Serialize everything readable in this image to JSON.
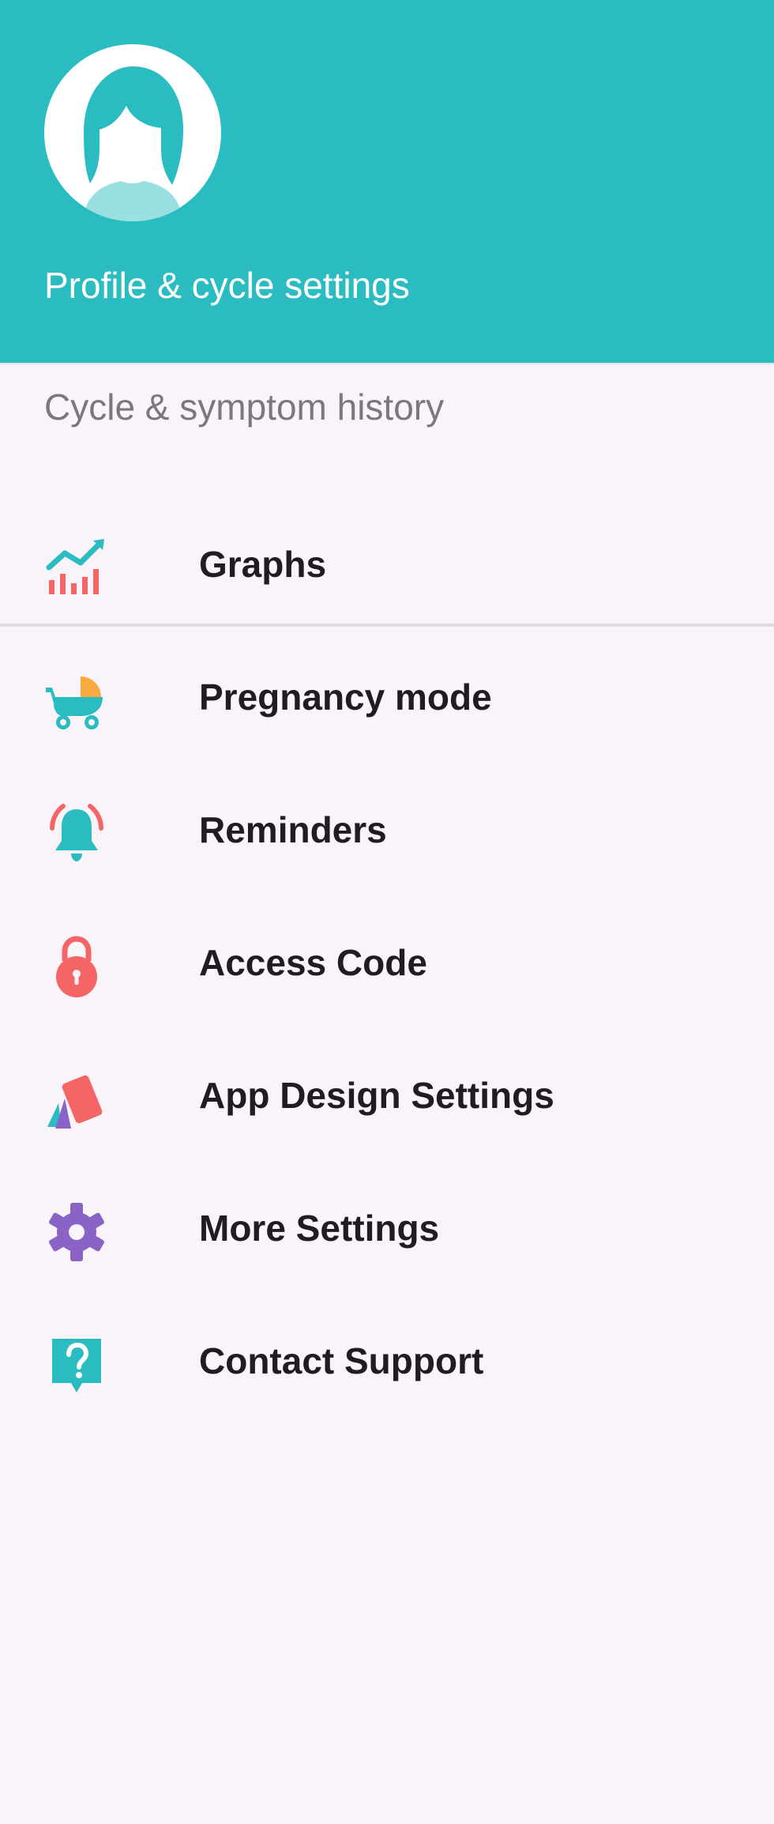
{
  "header": {
    "title": "Profile & cycle settings",
    "background_color": "#2bbcc2",
    "avatar_icon": "woman-avatar-icon"
  },
  "history": {
    "title": "Cycle & symptom history"
  },
  "menu": {
    "items": [
      {
        "label": "Graphs",
        "icon": "graphs-icon"
      },
      {
        "label": "Pregnancy mode",
        "icon": "stroller-icon"
      },
      {
        "label": "Reminders",
        "icon": "bell-icon"
      },
      {
        "label": "Access Code",
        "icon": "lock-icon"
      },
      {
        "label": "App Design Settings",
        "icon": "palette-cards-icon"
      },
      {
        "label": "More Settings",
        "icon": "gear-icon"
      },
      {
        "label": "Contact Support",
        "icon": "help-icon"
      }
    ]
  },
  "colors": {
    "accent": "#2bbcc2",
    "background": "#f9f4fa",
    "text_primary": "#1f1d22",
    "text_secondary": "#7b7780",
    "red": "#f56565",
    "orange": "#f9a93f",
    "purple": "#8a63c7"
  }
}
